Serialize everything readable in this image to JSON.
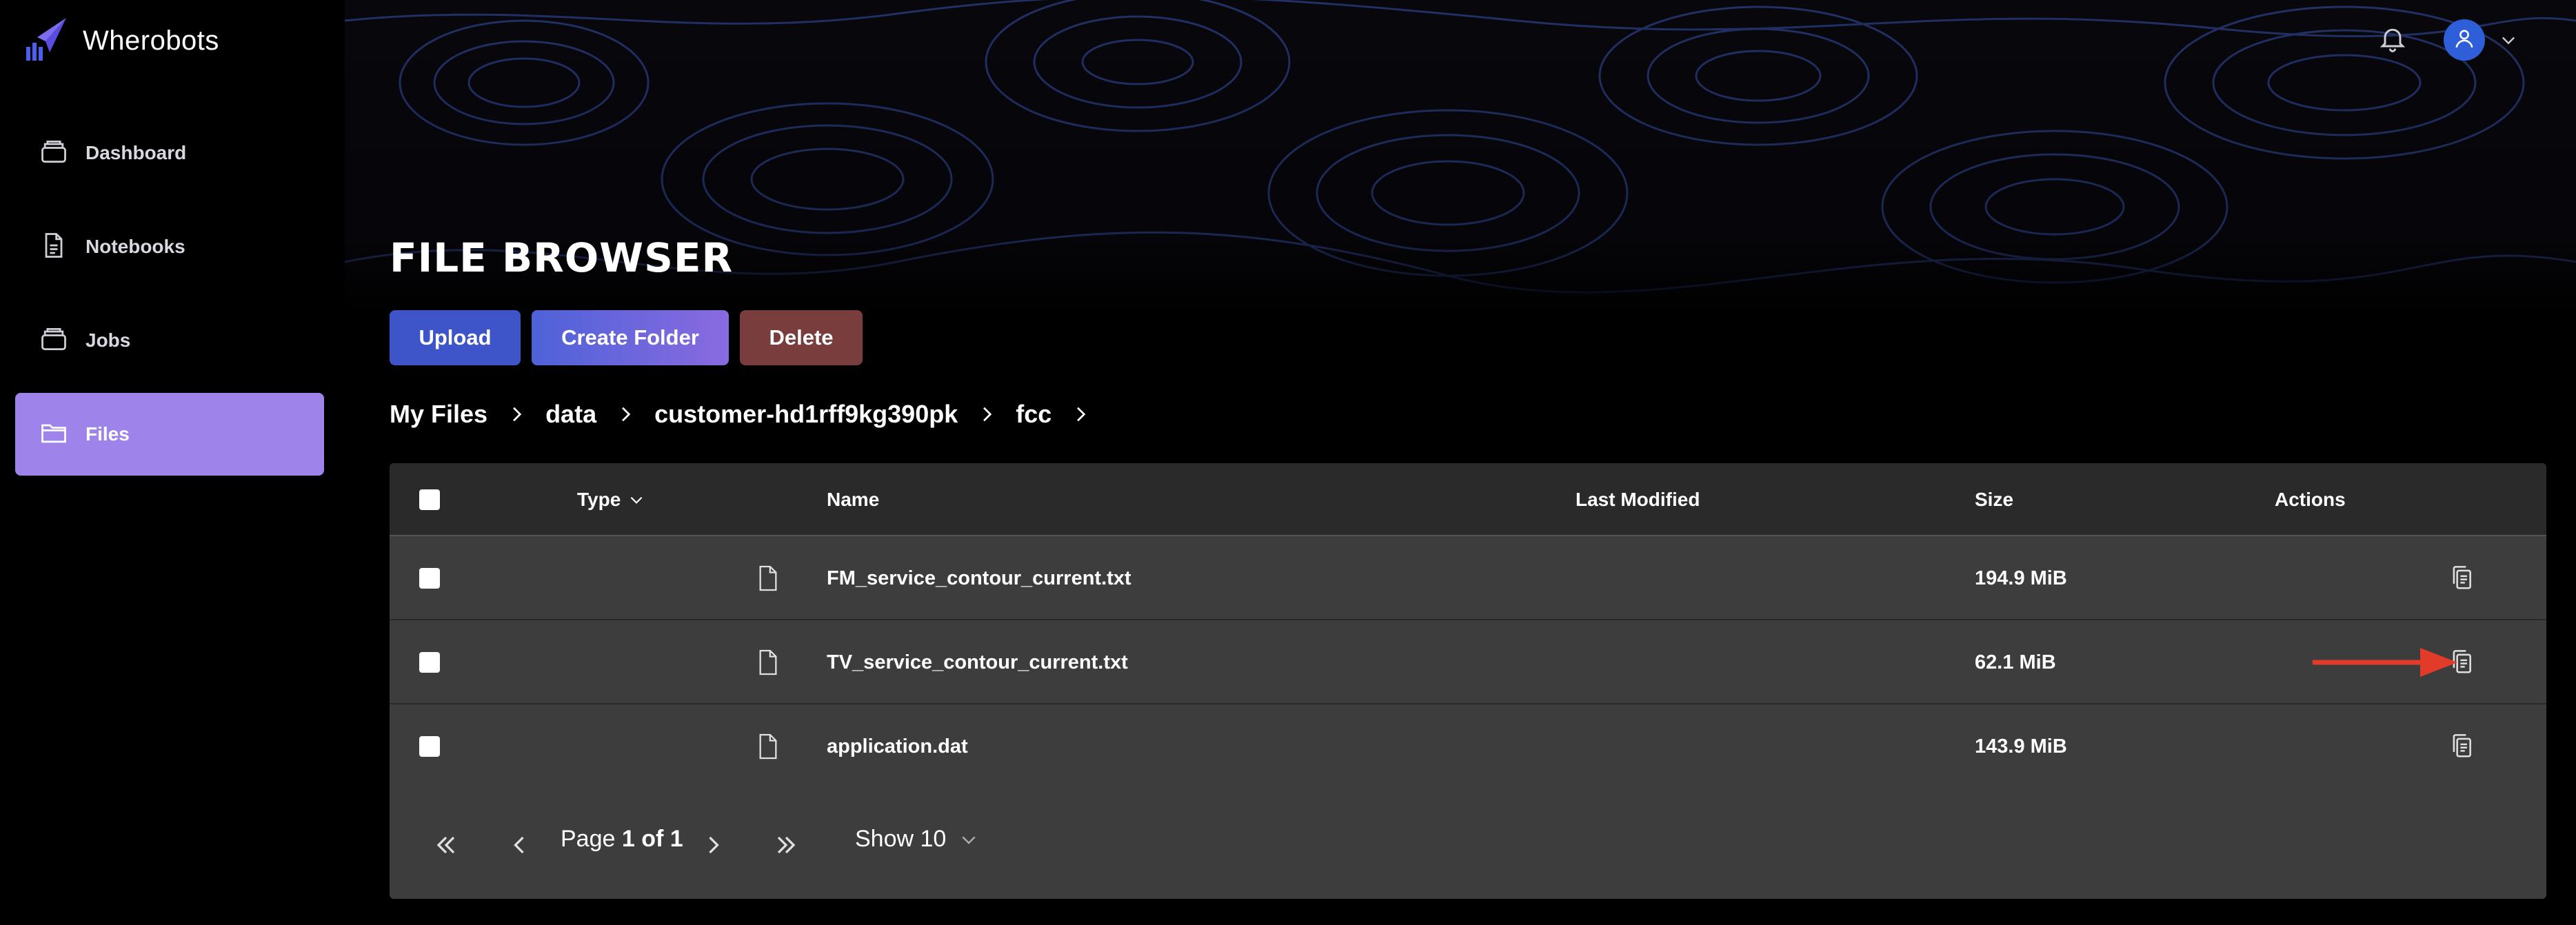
{
  "app": {
    "name": "Wherobots"
  },
  "sidebar": {
    "items": [
      {
        "label": "Dashboard",
        "icon": "database-icon",
        "active": false
      },
      {
        "label": "Notebooks",
        "icon": "document-icon",
        "active": false
      },
      {
        "label": "Jobs",
        "icon": "database-icon",
        "active": false
      },
      {
        "label": "Files",
        "icon": "folder-icon",
        "active": true
      }
    ]
  },
  "header": {
    "notification_icon": "bell-icon",
    "avatar_icon": "user-icon"
  },
  "page": {
    "title": "FILE BROWSER"
  },
  "toolbar": {
    "upload_label": "Upload",
    "create_folder_label": "Create Folder",
    "delete_label": "Delete"
  },
  "breadcrumb": [
    "My Files",
    "data",
    "customer-hd1rff9kg390pk",
    "fcc"
  ],
  "table": {
    "columns": {
      "type": "Type",
      "name": "Name",
      "modified": "Last Modified",
      "size": "Size",
      "actions": "Actions"
    },
    "rows": [
      {
        "name": "FM_service_contour_current.txt",
        "modified": "",
        "size": "194.9 MiB"
      },
      {
        "name": "TV_service_contour_current.txt",
        "modified": "",
        "size": "62.1 MiB"
      },
      {
        "name": "application.dat",
        "modified": "",
        "size": "143.9 MiB"
      }
    ]
  },
  "pagination": {
    "page_prefix": "Page",
    "page_current": "1 of 1",
    "show_label": "Show 10"
  },
  "colors": {
    "accent": "#9d83ea",
    "upload": "#3d55c8",
    "delete": "#7a3d3d",
    "annotation_arrow": "#e23b2a"
  }
}
